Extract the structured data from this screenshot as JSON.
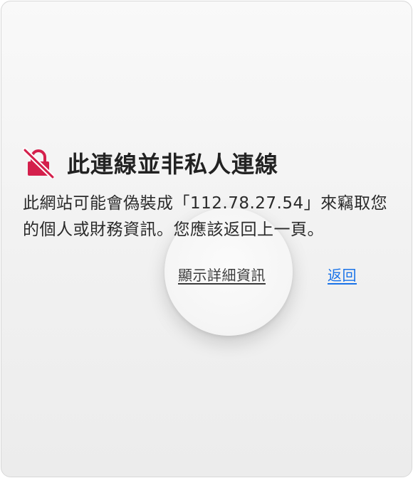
{
  "warning": {
    "icon": "not-secure-lock-icon",
    "icon_color": "#d4204c",
    "title": "此連線並非私人連線",
    "message": "此網站可能會偽裝成「112.78.27.54」來竊取您的個人或財務資訊。您應該返回上一頁。"
  },
  "actions": {
    "details_label": "顯示詳細資訊",
    "back_label": "返回",
    "link_color": "#1a73e8"
  }
}
